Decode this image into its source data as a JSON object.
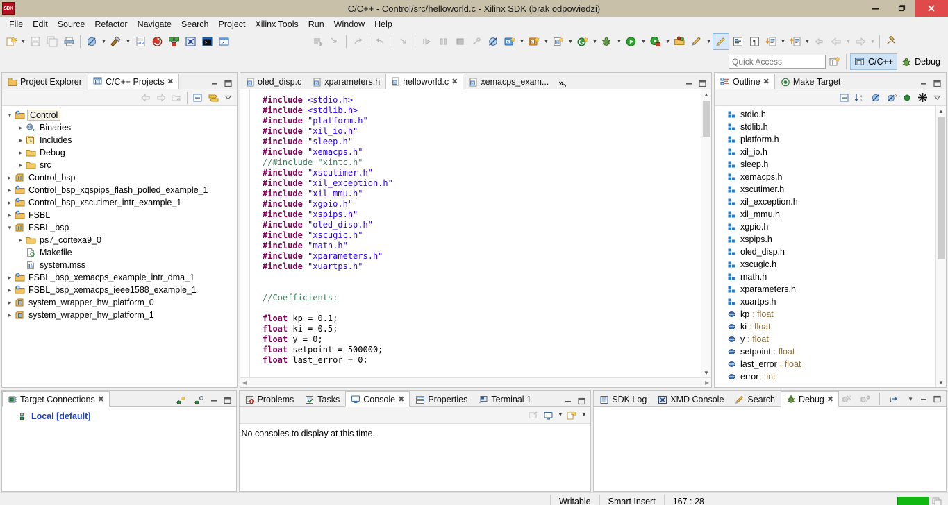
{
  "window": {
    "title": "C/C++ - Control/src/helloworld.c - Xilinx SDK (brak odpowiedzi)",
    "logo_text": "SDK",
    "minimize": "—",
    "maximize": "❐",
    "close": "✕"
  },
  "menubar": {
    "items": [
      "File",
      "Edit",
      "Source",
      "Refactor",
      "Navigate",
      "Search",
      "Project",
      "Xilinx Tools",
      "Run",
      "Window",
      "Help"
    ]
  },
  "quick_access": {
    "placeholder": "Quick Access",
    "value": "",
    "new_perspective_label": "",
    "perspectives": [
      {
        "label": "C/C++",
        "active": true
      },
      {
        "label": "Debug",
        "active": false
      }
    ]
  },
  "project_explorer": {
    "tabs": [
      {
        "label": "Project Explorer",
        "active": false,
        "closable": false
      },
      {
        "label": "C/C++ Projects",
        "active": true,
        "closable": true
      }
    ],
    "tree": [
      {
        "label": "Control",
        "indent": 0,
        "twist": "open",
        "icon": "c-project-icon",
        "selected": true
      },
      {
        "label": "Binaries",
        "indent": 1,
        "twist": "closed",
        "icon": "binaries-icon",
        "selected": false
      },
      {
        "label": "Includes",
        "indent": 1,
        "twist": "closed",
        "icon": "includes-icon",
        "selected": false
      },
      {
        "label": "Debug",
        "indent": 1,
        "twist": "closed",
        "icon": "folder-icon",
        "selected": false
      },
      {
        "label": "src",
        "indent": 1,
        "twist": "closed",
        "icon": "folder-icon",
        "selected": false
      },
      {
        "label": "Control_bsp",
        "indent": 0,
        "twist": "closed",
        "icon": "bsp-icon",
        "selected": false
      },
      {
        "label": "Control_bsp_xqspips_flash_polled_example_1",
        "indent": 0,
        "twist": "closed",
        "icon": "c-project-icon",
        "selected": false
      },
      {
        "label": "Control_bsp_xscutimer_intr_example_1",
        "indent": 0,
        "twist": "closed",
        "icon": "c-project-icon",
        "selected": false
      },
      {
        "label": "FSBL",
        "indent": 0,
        "twist": "closed",
        "icon": "c-project-icon",
        "selected": false
      },
      {
        "label": "FSBL_bsp",
        "indent": 0,
        "twist": "open",
        "icon": "bsp-icon",
        "selected": false
      },
      {
        "label": "ps7_cortexa9_0",
        "indent": 1,
        "twist": "closed",
        "icon": "folder-icon",
        "selected": false
      },
      {
        "label": "Makefile",
        "indent": 1,
        "twist": "none",
        "icon": "makefile-icon",
        "selected": false
      },
      {
        "label": "system.mss",
        "indent": 1,
        "twist": "none",
        "icon": "mss-icon",
        "selected": false
      },
      {
        "label": "FSBL_bsp_xemacps_example_intr_dma_1",
        "indent": 0,
        "twist": "closed",
        "icon": "c-project-icon",
        "selected": false
      },
      {
        "label": "FSBL_bsp_xemacps_ieee1588_example_1",
        "indent": 0,
        "twist": "closed",
        "icon": "c-project-icon",
        "selected": false
      },
      {
        "label": "system_wrapper_hw_platform_0",
        "indent": 0,
        "twist": "closed",
        "icon": "hw-platform-icon",
        "selected": false
      },
      {
        "label": "system_wrapper_hw_platform_1",
        "indent": 0,
        "twist": "closed",
        "icon": "hw-platform-icon",
        "selected": false
      }
    ]
  },
  "editor": {
    "tabs": [
      {
        "label": "oled_disp.c",
        "active": false,
        "closable": false
      },
      {
        "label": "xparameters.h",
        "active": false,
        "closable": false
      },
      {
        "label": "helloworld.c",
        "active": true,
        "closable": true
      },
      {
        "label": "xemacps_exam...",
        "active": false,
        "closable": false
      }
    ],
    "overflow_label": "»",
    "overflow_count": "5",
    "code_lines": [
      {
        "segments": [
          {
            "t": "#include ",
            "c": "pp"
          },
          {
            "t": "<stdio.h>",
            "c": "str"
          }
        ]
      },
      {
        "segments": [
          {
            "t": "#include ",
            "c": "pp"
          },
          {
            "t": "<stdlib.h>",
            "c": "str"
          }
        ]
      },
      {
        "segments": [
          {
            "t": "#include ",
            "c": "pp"
          },
          {
            "t": "\"platform.h\"",
            "c": "str"
          }
        ]
      },
      {
        "segments": [
          {
            "t": "#include ",
            "c": "pp"
          },
          {
            "t": "\"xil_io.h\"",
            "c": "str"
          }
        ]
      },
      {
        "segments": [
          {
            "t": "#include ",
            "c": "pp"
          },
          {
            "t": "\"sleep.h\"",
            "c": "str"
          }
        ]
      },
      {
        "segments": [
          {
            "t": "#include ",
            "c": "pp"
          },
          {
            "t": "\"xemacps.h\"",
            "c": "str"
          }
        ]
      },
      {
        "segments": [
          {
            "t": "//#include \"xintc.h\"",
            "c": "cmt"
          }
        ]
      },
      {
        "segments": [
          {
            "t": "#include ",
            "c": "pp"
          },
          {
            "t": "\"xscutimer.h\"",
            "c": "str"
          }
        ]
      },
      {
        "segments": [
          {
            "t": "#include ",
            "c": "pp"
          },
          {
            "t": "\"xil_exception.h\"",
            "c": "str"
          }
        ]
      },
      {
        "segments": [
          {
            "t": "#include ",
            "c": "pp"
          },
          {
            "t": "\"xil_mmu.h\"",
            "c": "str"
          }
        ]
      },
      {
        "segments": [
          {
            "t": "#include ",
            "c": "pp"
          },
          {
            "t": "\"xgpio.h\"",
            "c": "str"
          }
        ]
      },
      {
        "segments": [
          {
            "t": "#include ",
            "c": "pp"
          },
          {
            "t": "\"xspips.h\"",
            "c": "str"
          }
        ]
      },
      {
        "segments": [
          {
            "t": "#include ",
            "c": "pp"
          },
          {
            "t": "\"oled_disp.h\"",
            "c": "str"
          }
        ]
      },
      {
        "segments": [
          {
            "t": "#include ",
            "c": "pp"
          },
          {
            "t": "\"xscugic.h\"",
            "c": "str"
          }
        ]
      },
      {
        "segments": [
          {
            "t": "#include ",
            "c": "pp"
          },
          {
            "t": "\"math.h\"",
            "c": "str"
          }
        ]
      },
      {
        "segments": [
          {
            "t": "#include ",
            "c": "pp"
          },
          {
            "t": "\"xparameters.h\"",
            "c": "str"
          }
        ]
      },
      {
        "segments": [
          {
            "t": "#include ",
            "c": "pp"
          },
          {
            "t": "\"xuartps.h\"",
            "c": "str"
          }
        ]
      },
      {
        "segments": [
          {
            "t": "",
            "c": "num"
          }
        ]
      },
      {
        "segments": [
          {
            "t": "",
            "c": "num"
          }
        ]
      },
      {
        "segments": [
          {
            "t": "//Coefficients:",
            "c": "cmt"
          }
        ]
      },
      {
        "segments": [
          {
            "t": "",
            "c": "num"
          }
        ]
      },
      {
        "segments": [
          {
            "t": "float",
            "c": "kw"
          },
          {
            "t": " kp = 0.1;",
            "c": "num"
          }
        ]
      },
      {
        "segments": [
          {
            "t": "float",
            "c": "kw"
          },
          {
            "t": " ki = 0.5;",
            "c": "num"
          }
        ]
      },
      {
        "segments": [
          {
            "t": "float",
            "c": "kw"
          },
          {
            "t": " y = 0;",
            "c": "num"
          }
        ]
      },
      {
        "segments": [
          {
            "t": "float",
            "c": "kw"
          },
          {
            "t": " setpoint = 500000;",
            "c": "num"
          }
        ]
      },
      {
        "segments": [
          {
            "t": "float",
            "c": "kw"
          },
          {
            "t": " last_error = 0;",
            "c": "num"
          }
        ]
      }
    ]
  },
  "outline": {
    "tabs": [
      {
        "label": "Outline",
        "active": true,
        "closable": true
      },
      {
        "label": "Make Target",
        "active": false,
        "closable": false
      }
    ],
    "items": [
      {
        "label": "stdio.h",
        "type": "",
        "icon": "include-icon"
      },
      {
        "label": "stdlib.h",
        "type": "",
        "icon": "include-icon"
      },
      {
        "label": "platform.h",
        "type": "",
        "icon": "include-icon"
      },
      {
        "label": "xil_io.h",
        "type": "",
        "icon": "include-icon"
      },
      {
        "label": "sleep.h",
        "type": "",
        "icon": "include-icon"
      },
      {
        "label": "xemacps.h",
        "type": "",
        "icon": "include-icon"
      },
      {
        "label": "xscutimer.h",
        "type": "",
        "icon": "include-icon"
      },
      {
        "label": "xil_exception.h",
        "type": "",
        "icon": "include-icon"
      },
      {
        "label": "xil_mmu.h",
        "type": "",
        "icon": "include-icon"
      },
      {
        "label": "xgpio.h",
        "type": "",
        "icon": "include-icon"
      },
      {
        "label": "xspips.h",
        "type": "",
        "icon": "include-icon"
      },
      {
        "label": "oled_disp.h",
        "type": "",
        "icon": "include-icon"
      },
      {
        "label": "xscugic.h",
        "type": "",
        "icon": "include-icon"
      },
      {
        "label": "math.h",
        "type": "",
        "icon": "include-icon"
      },
      {
        "label": "xparameters.h",
        "type": "",
        "icon": "include-icon"
      },
      {
        "label": "xuartps.h",
        "type": "",
        "icon": "include-icon"
      },
      {
        "label": "kp",
        "type": ": float",
        "icon": "variable-icon"
      },
      {
        "label": "ki",
        "type": ": float",
        "icon": "variable-icon"
      },
      {
        "label": "y",
        "type": ": float",
        "icon": "variable-icon"
      },
      {
        "label": "setpoint",
        "type": ": float",
        "icon": "variable-icon"
      },
      {
        "label": "last_error",
        "type": ": float",
        "icon": "variable-icon"
      },
      {
        "label": "error",
        "type": ": int",
        "icon": "variable-icon"
      }
    ]
  },
  "target_connections": {
    "tabs": [
      {
        "label": "Target Connections",
        "active": true,
        "closable": true
      }
    ],
    "items": [
      {
        "label": "Local [default]"
      }
    ]
  },
  "console": {
    "tabs": [
      {
        "label": "Problems",
        "active": false,
        "closable": false
      },
      {
        "label": "Tasks",
        "active": false,
        "closable": false
      },
      {
        "label": "Console",
        "active": true,
        "closable": true
      },
      {
        "label": "Properties",
        "active": false,
        "closable": false
      },
      {
        "label": "Terminal 1",
        "active": false,
        "closable": false
      }
    ],
    "message": "No consoles to display at this time."
  },
  "debug_panel": {
    "tabs": [
      {
        "label": "SDK Log",
        "active": false,
        "closable": false
      },
      {
        "label": "XMD Console",
        "active": false,
        "closable": false
      },
      {
        "label": "Search",
        "active": false,
        "closable": false
      },
      {
        "label": "Debug",
        "active": true,
        "closable": true
      }
    ]
  },
  "statusbar": {
    "writable": "Writable",
    "insert_mode": "Smart Insert",
    "cursor_position": "167 : 28"
  },
  "colors": {
    "titlebar": "#c8c0a8",
    "close_button": "#e04a4a",
    "accent_selected_tab": "#cfe3f7",
    "keyword": "#7f0055",
    "string": "#2a00ff",
    "comment": "#3f7f5f",
    "link_text": "#1a3fd0",
    "progress_green": "#12b812"
  }
}
